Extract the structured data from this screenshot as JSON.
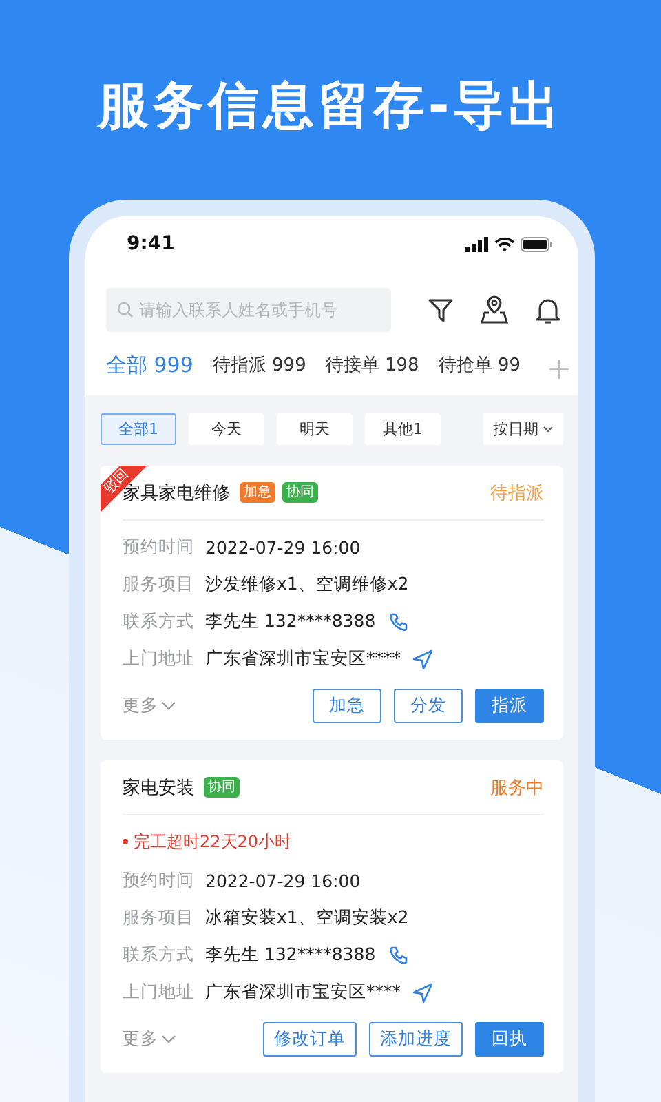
{
  "headline": "服务信息留存-导出",
  "status_bar": {
    "time": "9:41"
  },
  "search": {
    "placeholder": "请输入联系人姓名或手机号"
  },
  "tabs": [
    {
      "label": "全部 999",
      "selected": true
    },
    {
      "label": "待指派 999",
      "selected": false
    },
    {
      "label": "待接单 198",
      "selected": false
    },
    {
      "label": "待抢单 99",
      "selected": false
    }
  ],
  "add_tab": "+",
  "filters": [
    {
      "label": "全部1",
      "selected": true
    },
    {
      "label": "今天",
      "selected": false
    },
    {
      "label": "明天",
      "selected": false
    },
    {
      "label": "其他1",
      "selected": false
    }
  ],
  "sort": "按日期",
  "orders": [
    {
      "ribbon": "驳回",
      "title": "家具家电维修",
      "tags": [
        {
          "label": "加急",
          "color": "#f07a2c"
        },
        {
          "label": "协同",
          "color": "#3bb04b"
        }
      ],
      "status": {
        "label": "待指派",
        "color": "#f2a24e"
      },
      "fields": [
        {
          "kind": "text",
          "label": "预约时间",
          "value": "2022-07-29 16:00"
        },
        {
          "kind": "text",
          "label": "服务项目",
          "value": "沙发维修x1、空调维修x2"
        },
        {
          "kind": "phone",
          "label": "联系方式",
          "value": "李先生 132****8388"
        },
        {
          "kind": "address",
          "label": "上门地址",
          "value": "广东省深圳市宝安区****"
        }
      ],
      "more": "更多",
      "actions": [
        {
          "label": "加急",
          "primary": false
        },
        {
          "label": "分发",
          "primary": false
        },
        {
          "label": "指派",
          "primary": true
        }
      ]
    },
    {
      "title": "家电安装",
      "tags": [
        {
          "label": "协同",
          "color": "#3bb04b"
        }
      ],
      "status": {
        "label": "服务中",
        "color": "#f07c2a"
      },
      "alert": "完工超时22天20小时",
      "fields": [
        {
          "kind": "text",
          "label": "预约时间",
          "value": "2022-07-29 16:00"
        },
        {
          "kind": "text",
          "label": "服务项目",
          "value": "冰箱安装x1、空调安装x2"
        },
        {
          "kind": "phone",
          "label": "联系方式",
          "value": "李先生 132****8388"
        },
        {
          "kind": "address",
          "label": "上门地址",
          "value": "广东省深圳市宝安区****"
        }
      ],
      "more": "更多",
      "actions": [
        {
          "label": "修改订单",
          "primary": false
        },
        {
          "label": "添加进度",
          "primary": false
        },
        {
          "label": "回执",
          "primary": true
        }
      ]
    }
  ]
}
